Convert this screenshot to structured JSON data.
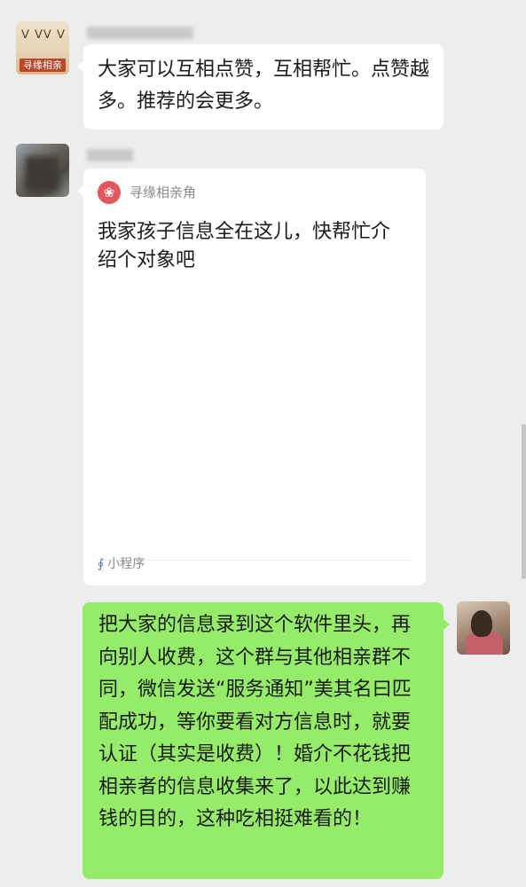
{
  "messages": [
    {
      "sender": "寻缘相亲",
      "text": "大家可以互相点赞，互相帮忙。点赞越多。推荐的会更多。"
    },
    {
      "type": "mini_program",
      "app_name": "寻缘相亲角",
      "title": "我家孩子信息全在这儿，快帮忙介绍个对象吧",
      "footer": "小程序"
    },
    {
      "type": "outgoing",
      "text": "把大家的信息录到这个软件里头，再向别人收费，这个群与其他相亲群不同，微信发送“服务通知”美其名曰匹配成功，等你要看对方信息时，就要认证（其实是收费）！婚介不花钱把相亲者的信息收集来了，以此达到赚钱的目的，这种吃相挺难看的！"
    }
  ],
  "avatar1_tag": "寻缘相亲",
  "icons": {
    "logo": "flower-logo-icon",
    "mini": "mini-program-icon"
  },
  "colors": {
    "background": "#ededed",
    "incoming": "#ffffff",
    "outgoing": "#95ec69",
    "logo": "#e3565c"
  }
}
